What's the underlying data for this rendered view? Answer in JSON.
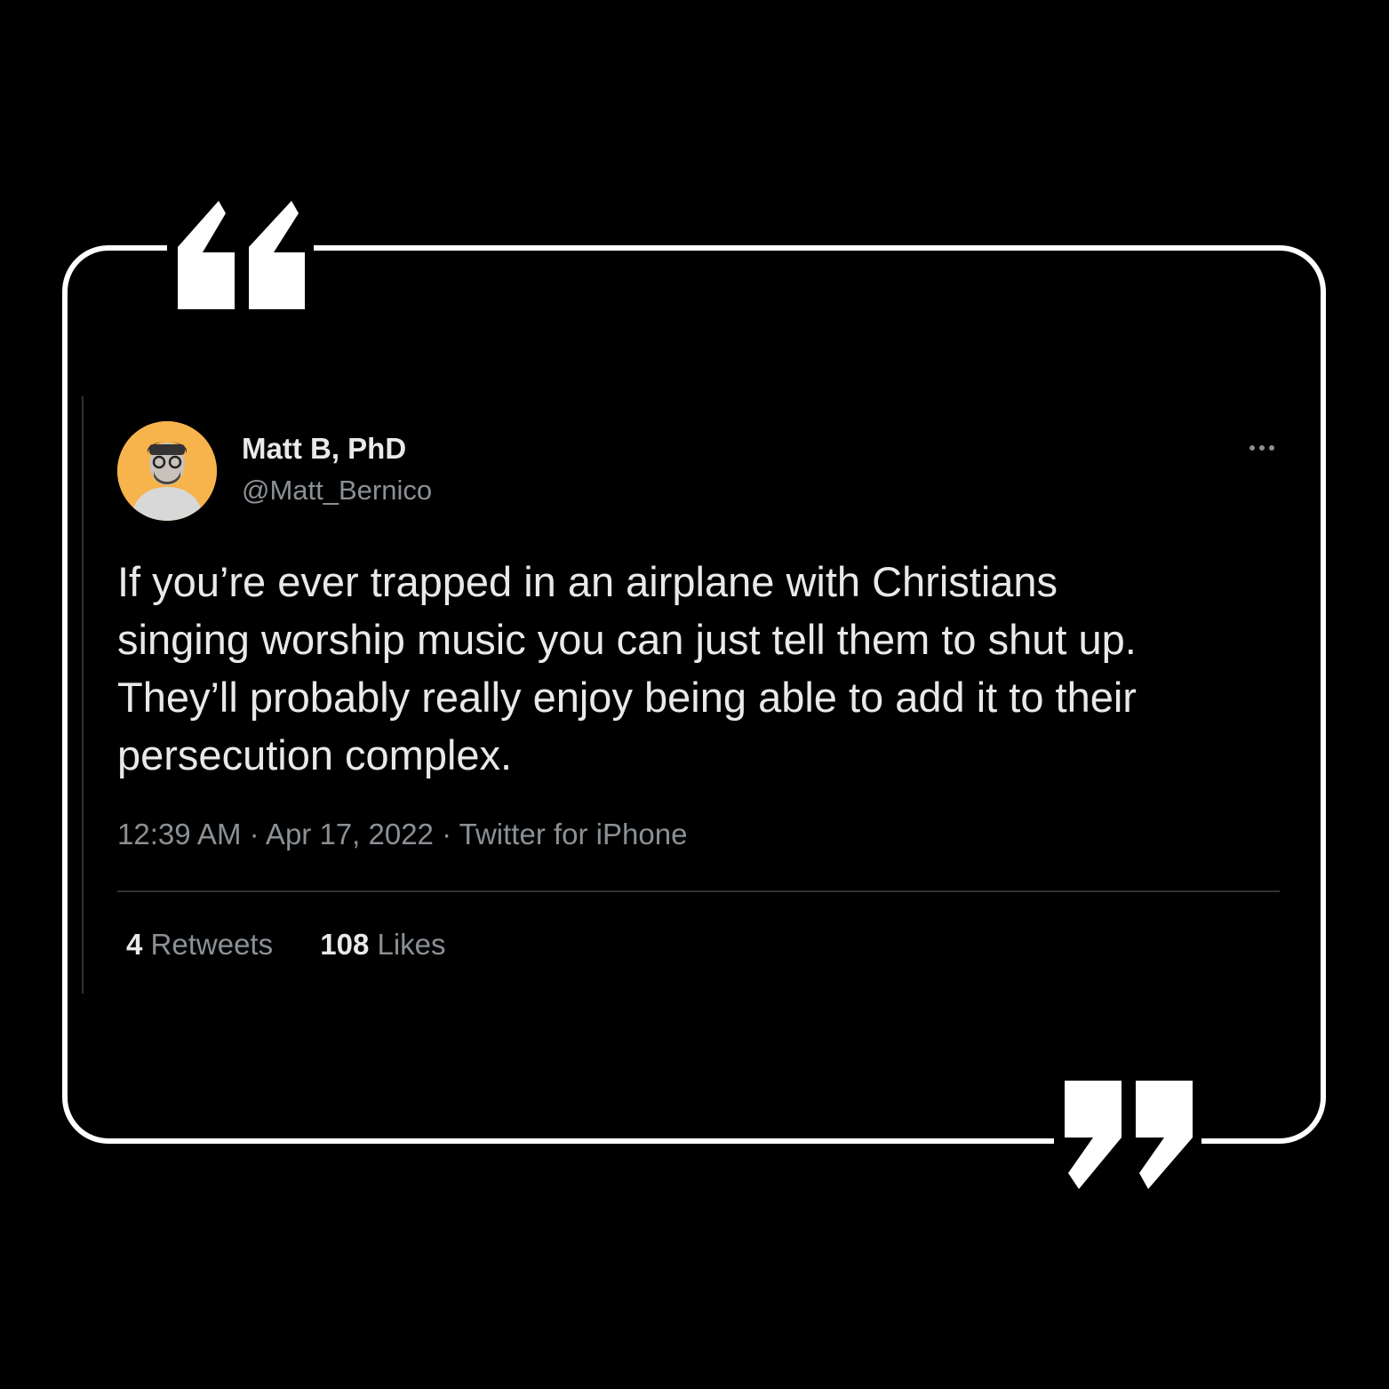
{
  "tweet": {
    "display_name": "Matt B, PhD",
    "handle": "@Matt_Bernico",
    "text": "If you’re ever trapped in an airplane with Christians\nsinging worship music you can just tell them to shut up.\nThey’ll probably really enjoy being able to add it to their\npersecution complex.",
    "meta": "12:39 AM · Apr 17, 2022 · Twitter for iPhone",
    "retweets_count": "4",
    "retweets_label": "Retweets",
    "likes_count": "108",
    "likes_label": "Likes"
  },
  "icons": {
    "more": "more-horizontal-icon",
    "open_quote": "open-quote-icon",
    "close_quote": "close-quote-icon"
  },
  "colors": {
    "background": "#000000",
    "frame": "#ffffff",
    "avatar_background": "#f7b34c",
    "secondary_text": "#8b9095"
  }
}
